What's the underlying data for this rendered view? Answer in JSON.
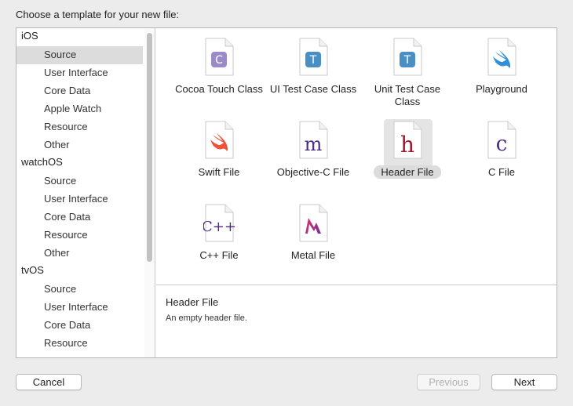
{
  "dialog": {
    "title": "Choose a template for your new file:"
  },
  "sidebar": {
    "platforms": [
      {
        "label": "iOS",
        "items": [
          "Source",
          "User Interface",
          "Core Data",
          "Apple Watch",
          "Resource",
          "Other"
        ]
      },
      {
        "label": "watchOS",
        "items": [
          "Source",
          "User Interface",
          "Core Data",
          "Resource",
          "Other"
        ]
      },
      {
        "label": "tvOS",
        "items": [
          "Source",
          "User Interface",
          "Core Data",
          "Resource"
        ]
      }
    ],
    "selected": "iOS / Source"
  },
  "templates": [
    {
      "label": "Cocoa Touch Class",
      "icon": "cocoa-touch-class-icon",
      "glyph": "C"
    },
    {
      "label": "UI Test Case Class",
      "icon": "ui-test-case-class-icon",
      "glyph": "T"
    },
    {
      "label": "Unit Test Case Class",
      "icon": "unit-test-case-class-icon",
      "glyph": "T"
    },
    {
      "label": "Playground",
      "icon": "playground-swift-icon"
    },
    {
      "label": "Swift File",
      "icon": "swift-file-icon"
    },
    {
      "label": "Objective-C File",
      "icon": "objective-c-file-icon",
      "glyph": "m"
    },
    {
      "label": "Header File",
      "icon": "header-file-icon",
      "glyph": "h",
      "selected": true
    },
    {
      "label": "C File",
      "icon": "c-file-icon",
      "glyph": "c"
    },
    {
      "label": "C++ File",
      "icon": "cpp-file-icon",
      "glyph": "C++"
    },
    {
      "label": "Metal File",
      "icon": "metal-file-icon"
    }
  ],
  "description": {
    "title": "Header File",
    "body": "An empty header file."
  },
  "buttons": {
    "cancel": "Cancel",
    "previous": "Previous",
    "next": "Next"
  },
  "colors": {
    "selection": "#dcdcdc",
    "objc_purple": "#4b2a86",
    "header_red": "#a3182e",
    "swift_orange": "#f05138",
    "test_blue": "#4a8fc4",
    "cocoa_purple": "#9b8ac8"
  }
}
